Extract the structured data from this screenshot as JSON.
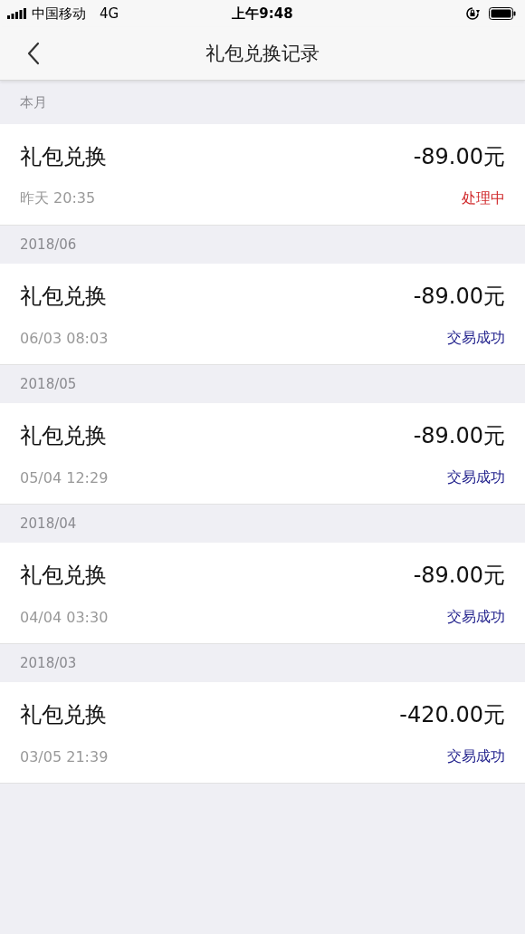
{
  "status_bar": {
    "carrier": "中国移动",
    "network": "4G",
    "time": "上午9:48"
  },
  "nav": {
    "title": "礼包兑换记录"
  },
  "sections": [
    {
      "label": "本月",
      "records": [
        {
          "title": "礼包兑换",
          "amount": "-89.00元",
          "time": "昨天 20:35",
          "status": "处理中",
          "kind": "processing"
        }
      ]
    },
    {
      "label": "2018/06",
      "records": [
        {
          "title": "礼包兑换",
          "amount": "-89.00元",
          "time": "06/03 08:03",
          "status": "交易成功",
          "kind": "success"
        }
      ]
    },
    {
      "label": "2018/05",
      "records": [
        {
          "title": "礼包兑换",
          "amount": "-89.00元",
          "time": "05/04 12:29",
          "status": "交易成功",
          "kind": "success"
        }
      ]
    },
    {
      "label": "2018/04",
      "records": [
        {
          "title": "礼包兑换",
          "amount": "-89.00元",
          "time": "04/04 03:30",
          "status": "交易成功",
          "kind": "success"
        }
      ]
    },
    {
      "label": "2018/03",
      "records": [
        {
          "title": "礼包兑换",
          "amount": "-420.00元",
          "time": "03/05 21:39",
          "status": "交易成功",
          "kind": "success"
        }
      ]
    }
  ]
}
